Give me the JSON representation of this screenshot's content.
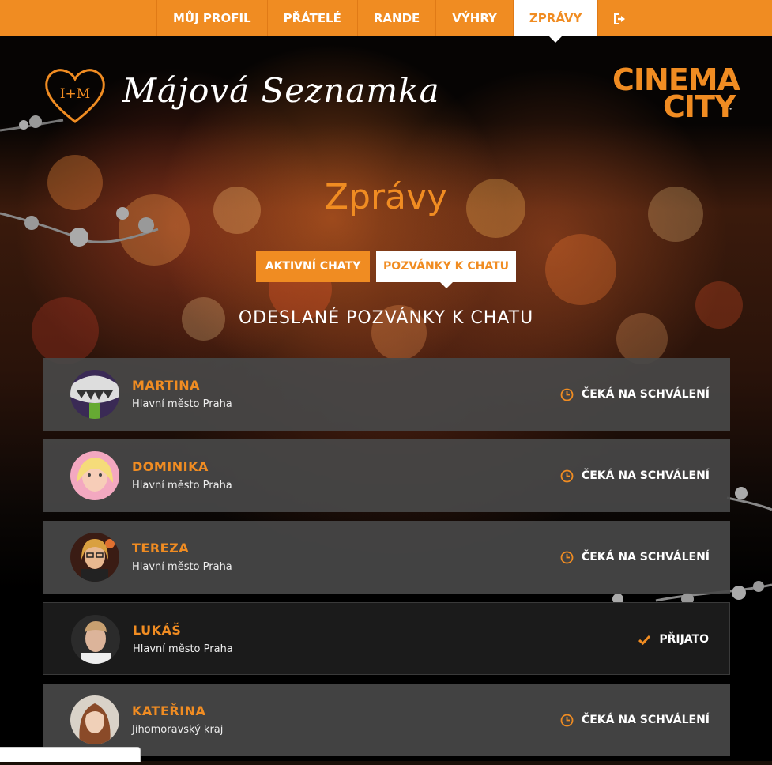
{
  "nav": {
    "items": [
      {
        "label": "MŮJ PROFIL",
        "active": false
      },
      {
        "label": "PŘÁTELÉ",
        "active": false
      },
      {
        "label": "RANDE",
        "active": false
      },
      {
        "label": "VÝHRY",
        "active": false
      },
      {
        "label": "ZPRÁVY",
        "active": true
      }
    ],
    "logout_icon": "sign-out-icon"
  },
  "header": {
    "monogram": "I+M",
    "site_name": "Májová Seznamka",
    "partner_logo": {
      "line1": "CINEMA",
      "line2": "CITY",
      "tm": "™"
    }
  },
  "page": {
    "title": "Zprávy",
    "tabs": [
      {
        "label": "AKTIVNÍ CHATY",
        "selected": false
      },
      {
        "label": "POZVÁNKY K CHATU",
        "selected": true
      }
    ],
    "section_title": "ODESLANÉ POZVÁNKY K CHATU"
  },
  "invitations": [
    {
      "name": "MARTINA",
      "region": "Hlavní město Praha",
      "status": "ČEKÁ NA SCHVÁLENÍ",
      "status_icon": "clock-icon"
    },
    {
      "name": "DOMINIKA",
      "region": "Hlavní město Praha",
      "status": "ČEKÁ NA SCHVÁLENÍ",
      "status_icon": "clock-icon"
    },
    {
      "name": "TEREZA",
      "region": "Hlavní město Praha",
      "status": "ČEKÁ NA SCHVÁLENÍ",
      "status_icon": "clock-icon"
    },
    {
      "name": "LUKÁŠ",
      "region": "Hlavní město Praha",
      "status": "PŘIJATO",
      "status_icon": "check-icon"
    },
    {
      "name": "KATEŘINA",
      "region": "Jihomoravský kraj",
      "status": "ČEKÁ NA SCHVÁLENÍ",
      "status_icon": "clock-icon"
    }
  ],
  "colors": {
    "accent": "#f08c22",
    "row_bg": "#484848",
    "accepted_row_bg": "#1b1b1b"
  }
}
